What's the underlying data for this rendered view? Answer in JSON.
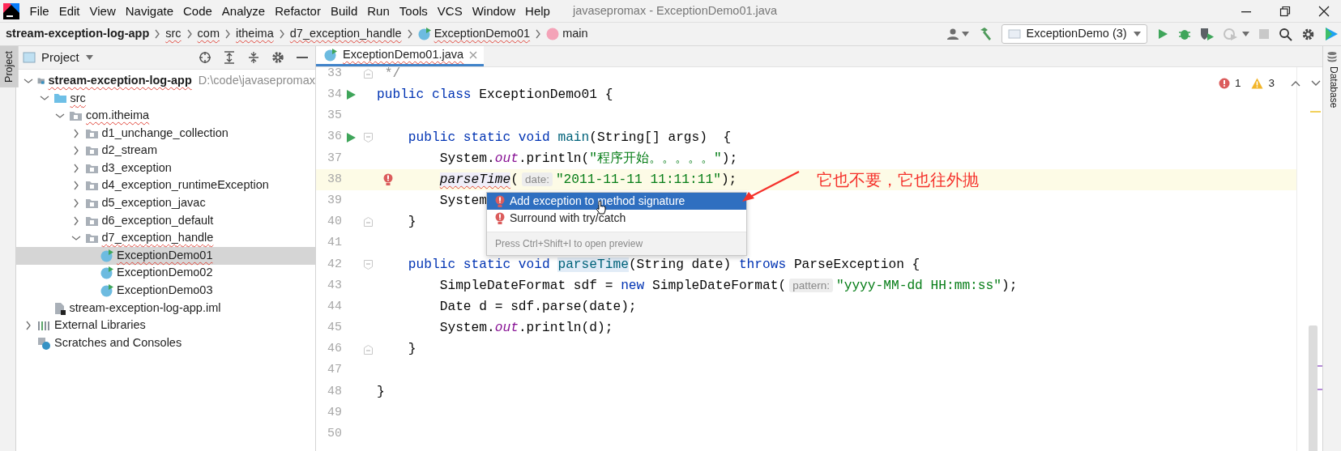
{
  "menu_bar": {
    "items": [
      "File",
      "Edit",
      "View",
      "Navigate",
      "Code",
      "Analyze",
      "Refactor",
      "Build",
      "Run",
      "Tools",
      "VCS",
      "Window",
      "Help"
    ],
    "title": "javasepromax - ExceptionDemo01.java"
  },
  "breadcrumbs": [
    {
      "label": "stream-exception-log-app",
      "kind": "project",
      "typo": false
    },
    {
      "label": "src",
      "kind": "folder",
      "typo": true
    },
    {
      "label": "com",
      "kind": "folder",
      "typo": true
    },
    {
      "label": "itheima",
      "kind": "folder",
      "typo": true
    },
    {
      "label": "d7_exception_handle",
      "kind": "folder",
      "typo": true
    },
    {
      "label": "ExceptionDemo01",
      "kind": "class",
      "typo": true
    },
    {
      "label": "main",
      "kind": "method",
      "typo": false
    }
  ],
  "toolbar": {
    "run_config": "ExceptionDemo (3)"
  },
  "left_stripe": {
    "label": "Project",
    "selected": true
  },
  "project_panel": {
    "title": "Project",
    "tree": [
      {
        "label": "stream-exception-log-app",
        "kind": "project",
        "hint": "D:\\code\\javasepromax",
        "expanded": true,
        "selected": false,
        "typo": true,
        "children": [
          {
            "label": "src",
            "kind": "source_folder",
            "expanded": true,
            "selected": false,
            "typo": true,
            "children": [
              {
                "label": "com.itheima",
                "kind": "package",
                "expanded": true,
                "selected": false,
                "typo": true,
                "children": [
                  {
                    "label": "d1_unchange_collection",
                    "kind": "package",
                    "expanded": false,
                    "selected": false,
                    "typo": false
                  },
                  {
                    "label": "d2_stream",
                    "kind": "package",
                    "expanded": false,
                    "selected": false,
                    "typo": false
                  },
                  {
                    "label": "d3_exception",
                    "kind": "package",
                    "expanded": false,
                    "selected": false,
                    "typo": false
                  },
                  {
                    "label": "d4_exception_runtimeException",
                    "kind": "package",
                    "expanded": false,
                    "selected": false,
                    "typo": false
                  },
                  {
                    "label": "d5_exception_javac",
                    "kind": "package",
                    "expanded": false,
                    "selected": false,
                    "typo": false
                  },
                  {
                    "label": "d6_exception_default",
                    "kind": "package",
                    "expanded": false,
                    "selected": false,
                    "typo": false
                  },
                  {
                    "label": "d7_exception_handle",
                    "kind": "package",
                    "expanded": true,
                    "selected": false,
                    "typo": true,
                    "children": [
                      {
                        "label": "ExceptionDemo01",
                        "kind": "class",
                        "selected": true,
                        "typo": true
                      },
                      {
                        "label": "ExceptionDemo02",
                        "kind": "class",
                        "selected": false,
                        "typo": false
                      },
                      {
                        "label": "ExceptionDemo03",
                        "kind": "class",
                        "selected": false,
                        "typo": false
                      }
                    ]
                  }
                ]
              }
            ]
          },
          {
            "label": "stream-exception-log-app.iml",
            "kind": "module_file",
            "selected": false,
            "typo": false
          }
        ]
      },
      {
        "label": "External Libraries",
        "kind": "libraries",
        "expanded": false,
        "selected": false,
        "typo": false
      },
      {
        "label": "Scratches and Consoles",
        "kind": "scratches",
        "selected": false,
        "typo": false
      }
    ]
  },
  "editor": {
    "tabs": [
      {
        "label": "ExceptionDemo01.java",
        "selected": true,
        "typo": true
      }
    ],
    "problems": {
      "errors": "1",
      "warnings": "3"
    },
    "lines": [
      {
        "number": "33",
        "gutter": [
          {
            "kind": "fold_end"
          }
        ],
        "highlighted": false,
        "tokens": [
          {
            "t": " */",
            "kind": "comment"
          }
        ]
      },
      {
        "number": "34",
        "gutter": [
          {
            "kind": "run"
          }
        ],
        "highlighted": false,
        "tokens": [
          {
            "t": "public class ",
            "kind": "keyword"
          },
          {
            "t": "ExceptionDemo01 {",
            "kind": "plain"
          }
        ]
      },
      {
        "number": "35",
        "highlighted": false
      },
      {
        "number": "36",
        "gutter": [
          {
            "kind": "run"
          },
          {
            "kind": "fold_start"
          }
        ],
        "highlighted": false,
        "tokens": [
          {
            "t": "    public static void ",
            "kind": "keyword"
          },
          {
            "t": "main",
            "kind": "decl"
          },
          {
            "t": "(String[] args)  {",
            "kind": "plain"
          }
        ]
      },
      {
        "number": "37",
        "highlighted": false,
        "tokens": [
          {
            "t": "        System.",
            "kind": "plain"
          },
          {
            "t": "out",
            "kind": "field"
          },
          {
            "t": ".println(",
            "kind": "plain"
          },
          {
            "t": "\"程序开始。。。。。\"",
            "kind": "string"
          },
          {
            "t": ");",
            "kind": "plain"
          }
        ]
      },
      {
        "number": "38",
        "gutter": [
          {
            "kind": "error"
          }
        ],
        "highlighted": true,
        "tokens": [
          {
            "t": "        parseTime",
            "kind": "error_call"
          },
          {
            "t": "(",
            "kind": "plain"
          },
          {
            "t": "date:",
            "kind": "hint"
          },
          {
            "t": "\"2011-11-11 11:11:11\"",
            "kind": "string"
          },
          {
            "t": ");",
            "kind": "plain"
          }
        ]
      },
      {
        "number": "39",
        "highlighted": false,
        "tokens": [
          {
            "t": "        System",
            "kind": "plain"
          }
        ]
      },
      {
        "number": "40",
        "gutter": [
          {
            "kind": "fold_end"
          }
        ],
        "highlighted": false,
        "tokens": [
          {
            "t": "    }",
            "kind": "plain"
          }
        ]
      },
      {
        "number": "41",
        "highlighted": false
      },
      {
        "number": "42",
        "gutter": [
          {
            "kind": "fold_start"
          }
        ],
        "highlighted": false,
        "tokens": [
          {
            "t": "    public static void ",
            "kind": "keyword"
          },
          {
            "t": "parseTime",
            "kind": "decl_usage"
          },
          {
            "t": "(String date) ",
            "kind": "plain"
          },
          {
            "t": "throws",
            "kind": "keyword"
          },
          {
            "t": " ParseException {",
            "kind": "plain"
          }
        ]
      },
      {
        "number": "43",
        "highlighted": false,
        "tokens": [
          {
            "t": "        SimpleDateFormat sdf = ",
            "kind": "plain"
          },
          {
            "t": "new",
            "kind": "keyword"
          },
          {
            "t": " SimpleDateFormat(",
            "kind": "plain"
          },
          {
            "t": "pattern:",
            "kind": "hint"
          },
          {
            "t": "\"yyyy-MM-dd HH:mm:ss\"",
            "kind": "string"
          },
          {
            "t": ");",
            "kind": "plain"
          }
        ]
      },
      {
        "number": "44",
        "highlighted": false,
        "tokens": [
          {
            "t": "        Date d = sdf.parse(date);",
            "kind": "plain"
          }
        ]
      },
      {
        "number": "45",
        "highlighted": false,
        "tokens": [
          {
            "t": "        System.",
            "kind": "plain"
          },
          {
            "t": "out",
            "kind": "field"
          },
          {
            "t": ".println(d);",
            "kind": "plain"
          }
        ]
      },
      {
        "number": "46",
        "gutter": [
          {
            "kind": "fold_end"
          }
        ],
        "highlighted": false,
        "tokens": [
          {
            "t": "    }",
            "kind": "plain"
          }
        ]
      },
      {
        "number": "47",
        "highlighted": false
      },
      {
        "number": "48",
        "highlighted": false,
        "tokens": [
          {
            "t": "}",
            "kind": "plain"
          }
        ]
      },
      {
        "number": "49",
        "highlighted": false
      },
      {
        "number": "50",
        "highlighted": false
      }
    ],
    "popup": {
      "items": [
        {
          "label": "Add exception to method signature",
          "selected": true
        },
        {
          "label": "Surround with try/catch",
          "selected": false
        }
      ],
      "footer": "Press Ctrl+Shift+I to open preview"
    },
    "annotation": {
      "text": "它也不要，它也往外抛"
    }
  },
  "right_stripe": {
    "label": "Database"
  }
}
